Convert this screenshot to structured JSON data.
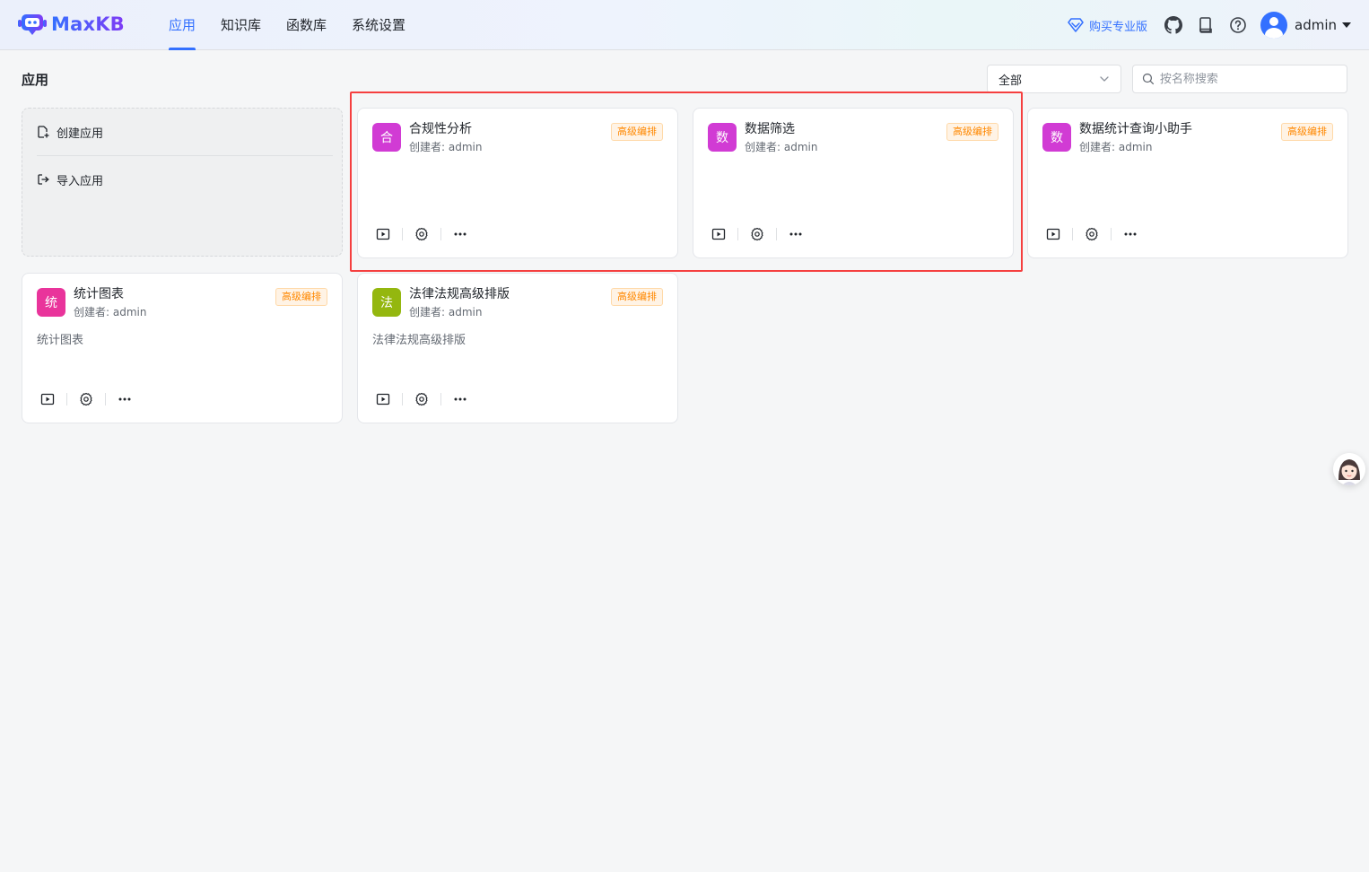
{
  "header": {
    "logo_text": "MaxKB",
    "nav": [
      {
        "label": "应用",
        "active": true
      },
      {
        "label": "知识库",
        "active": false
      },
      {
        "label": "函数库",
        "active": false
      },
      {
        "label": "系统设置",
        "active": false
      }
    ],
    "pro_label": "购买专业版",
    "user_name": "admin"
  },
  "page": {
    "title": "应用",
    "filter_value": "全部",
    "search_placeholder": "按名称搜索"
  },
  "create": {
    "create_label": "创建应用",
    "import_label": "导入应用"
  },
  "apps": [
    {
      "icon_char": "合",
      "icon_color": "#d13bd4",
      "name": "合规性分析",
      "creator": "创建者: admin",
      "badge": "高级编排",
      "desc": ""
    },
    {
      "icon_char": "数",
      "icon_color": "#d13bd4",
      "name": "数据筛选",
      "creator": "创建者: admin",
      "badge": "高级编排",
      "desc": ""
    },
    {
      "icon_char": "数",
      "icon_color": "#d13bd4",
      "name": "数据统计查询小助手",
      "creator": "创建者: admin",
      "badge": "高级编排",
      "desc": ""
    },
    {
      "icon_char": "统",
      "icon_color": "#e9349b",
      "name": "统计图表",
      "creator": "创建者: admin",
      "badge": "高级编排",
      "desc": "统计图表"
    },
    {
      "icon_char": "法",
      "icon_color": "#94b70f",
      "name": "法律法规高级排版",
      "creator": "创建者: admin",
      "badge": "高级编排",
      "desc": "法律法规高级排版"
    }
  ],
  "colors": {
    "accent": "#3370ff",
    "badge_text": "#ff8800",
    "highlight": "#f53f3f"
  }
}
